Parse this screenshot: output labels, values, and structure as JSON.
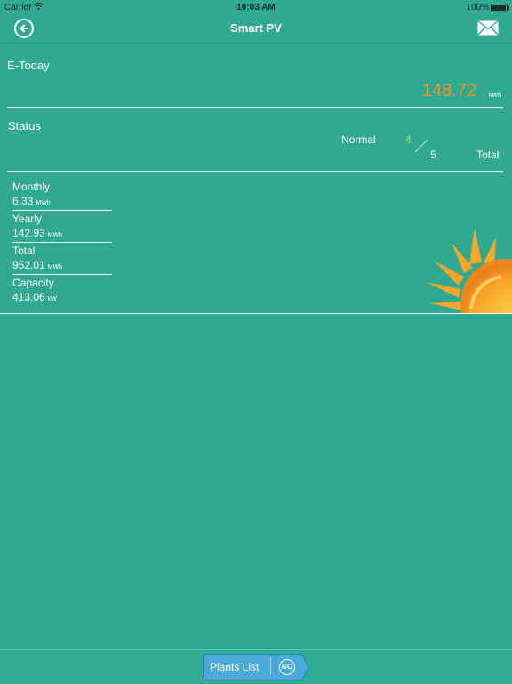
{
  "status_bar": {
    "carrier": "Carrier",
    "time": "10:03 AM",
    "battery": "100%"
  },
  "header": {
    "title": "Smart PV",
    "back_icon": "back-arrow-icon",
    "mail_icon": "mail-icon"
  },
  "etoday": {
    "label": "E-Today",
    "value": "148.72",
    "unit": "kWh"
  },
  "status": {
    "label": "Status",
    "normal_label": "Normal",
    "normal_count": "4",
    "total_count": "5",
    "total_label": "Total"
  },
  "stats": [
    {
      "label": "Monthly",
      "value": "6.33",
      "unit": "MWh"
    },
    {
      "label": "Yearly",
      "value": "142.93",
      "unit": "MWh"
    },
    {
      "label": "Total",
      "value": "952.01",
      "unit": "MWh"
    },
    {
      "label": "Capacity",
      "value": "413.06",
      "unit": "kW"
    }
  ],
  "footer": {
    "plants_list": "Plants List",
    "go": "GO"
  },
  "colors": {
    "background": "#31a890",
    "accent_orange": "#f0962d",
    "normal_green": "#9ef25a",
    "button_blue": "#4aa9d6"
  }
}
